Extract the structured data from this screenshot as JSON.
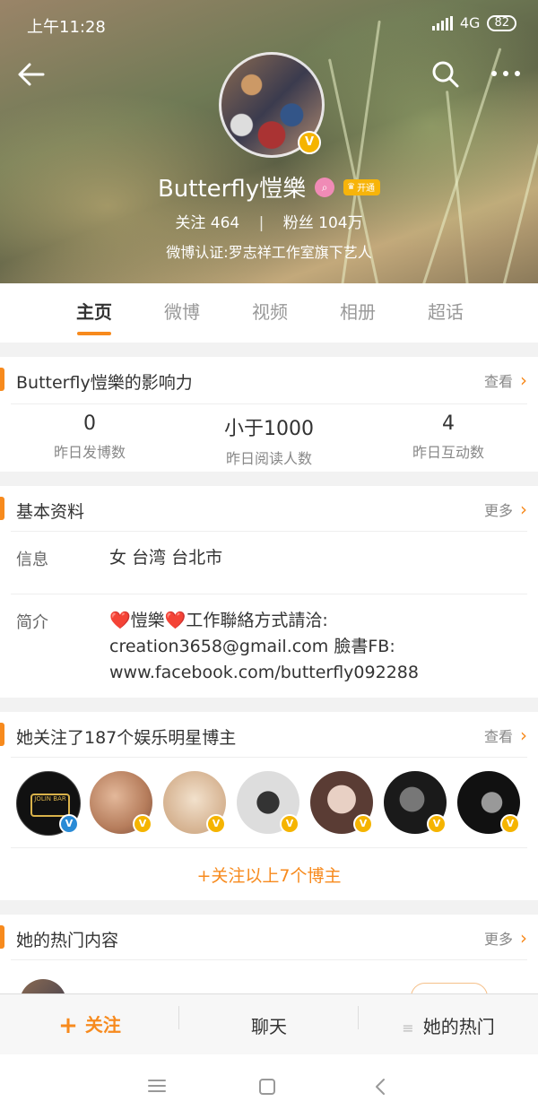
{
  "status_bar": {
    "time": "上午11:28",
    "network": "4G",
    "battery": "82"
  },
  "profile": {
    "name": "Butterfly愷樂",
    "vip_label": "开通",
    "following_label": "关注",
    "following_count": "464",
    "followers_label": "粉丝",
    "followers_count": "104万",
    "verification": "微博认证:罗志祥工作室旗下艺人"
  },
  "tabs": [
    "主页",
    "微博",
    "视频",
    "相册",
    "超话"
  ],
  "influence": {
    "title": "Butterfly愷樂的影响力",
    "link": "查看",
    "stats": [
      {
        "value": "0",
        "label": "昨日发博数"
      },
      {
        "value": "小于1000",
        "label": "昨日阅读人数"
      },
      {
        "value": "4",
        "label": "昨日互动数"
      }
    ]
  },
  "basic_info": {
    "title": "基本资料",
    "link": "更多",
    "info_label": "信息",
    "info_value": "女 台湾 台北市",
    "bio_label": "简介",
    "bio_line1": "❤️愷樂❤️工作聯絡方式請洽:",
    "bio_line2": "creation3658@gmail.com 臉書FB:",
    "bio_line3": "www.facebook.com/butterfly092288"
  },
  "following_section": {
    "title": "她关注了187个娱乐明星博主",
    "link": "查看",
    "follow_all": "+关注以上7个博主",
    "avatar_logo_text": "JOLIN BAR"
  },
  "hot_content": {
    "title": "她的热门内容",
    "link": "更多"
  },
  "bottom_bar": {
    "follow": "关注",
    "chat": "聊天",
    "hot": "她的热门"
  },
  "colors": {
    "accent": "#f78a1d",
    "verified_yellow": "#f5b400",
    "verified_blue": "#2a8bd6"
  }
}
